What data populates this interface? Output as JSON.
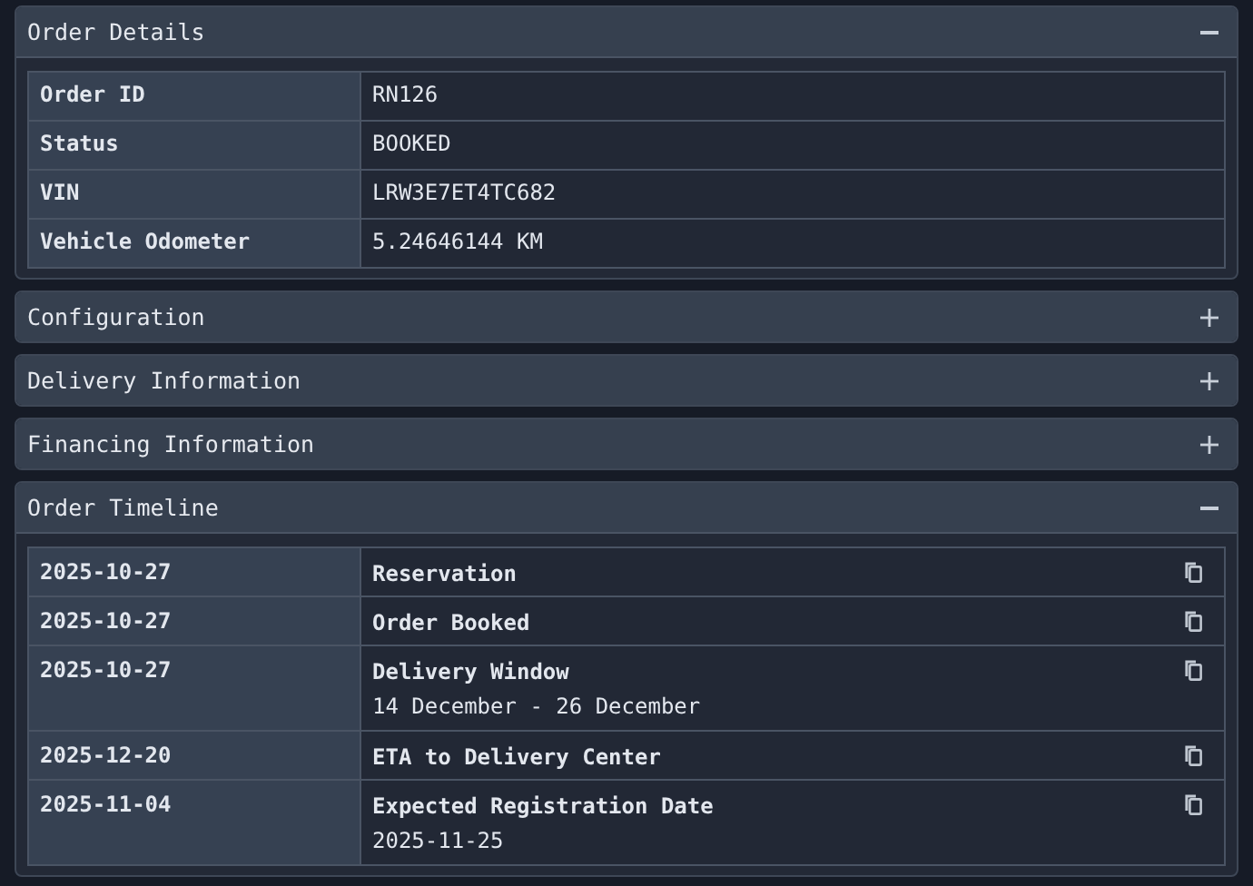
{
  "sections": [
    {
      "title": "Order Details",
      "expanded": true,
      "kind": "details",
      "rows": [
        {
          "label": "Order ID",
          "value": "RN126"
        },
        {
          "label": "Status",
          "value": "BOOKED"
        },
        {
          "label": "VIN",
          "value": "LRW3E7ET4TC682"
        },
        {
          "label": "Vehicle Odometer",
          "value": "5.24646144 KM"
        }
      ]
    },
    {
      "title": "Configuration",
      "expanded": false
    },
    {
      "title": "Delivery Information",
      "expanded": false
    },
    {
      "title": "Financing Information",
      "expanded": false
    },
    {
      "title": "Order Timeline",
      "expanded": true,
      "kind": "timeline",
      "events": [
        {
          "date": "2025-10-27",
          "event": "Reservation"
        },
        {
          "date": "2025-10-27",
          "event": "Order Booked"
        },
        {
          "date": "2025-10-27",
          "event": "Delivery Window",
          "detail": "14 December - 26 December"
        },
        {
          "date": "2025-12-20",
          "event": "ETA to Delivery Center"
        },
        {
          "date": "2025-11-04",
          "event": "Expected Registration Date",
          "detail": "2025-11-25"
        }
      ]
    }
  ]
}
